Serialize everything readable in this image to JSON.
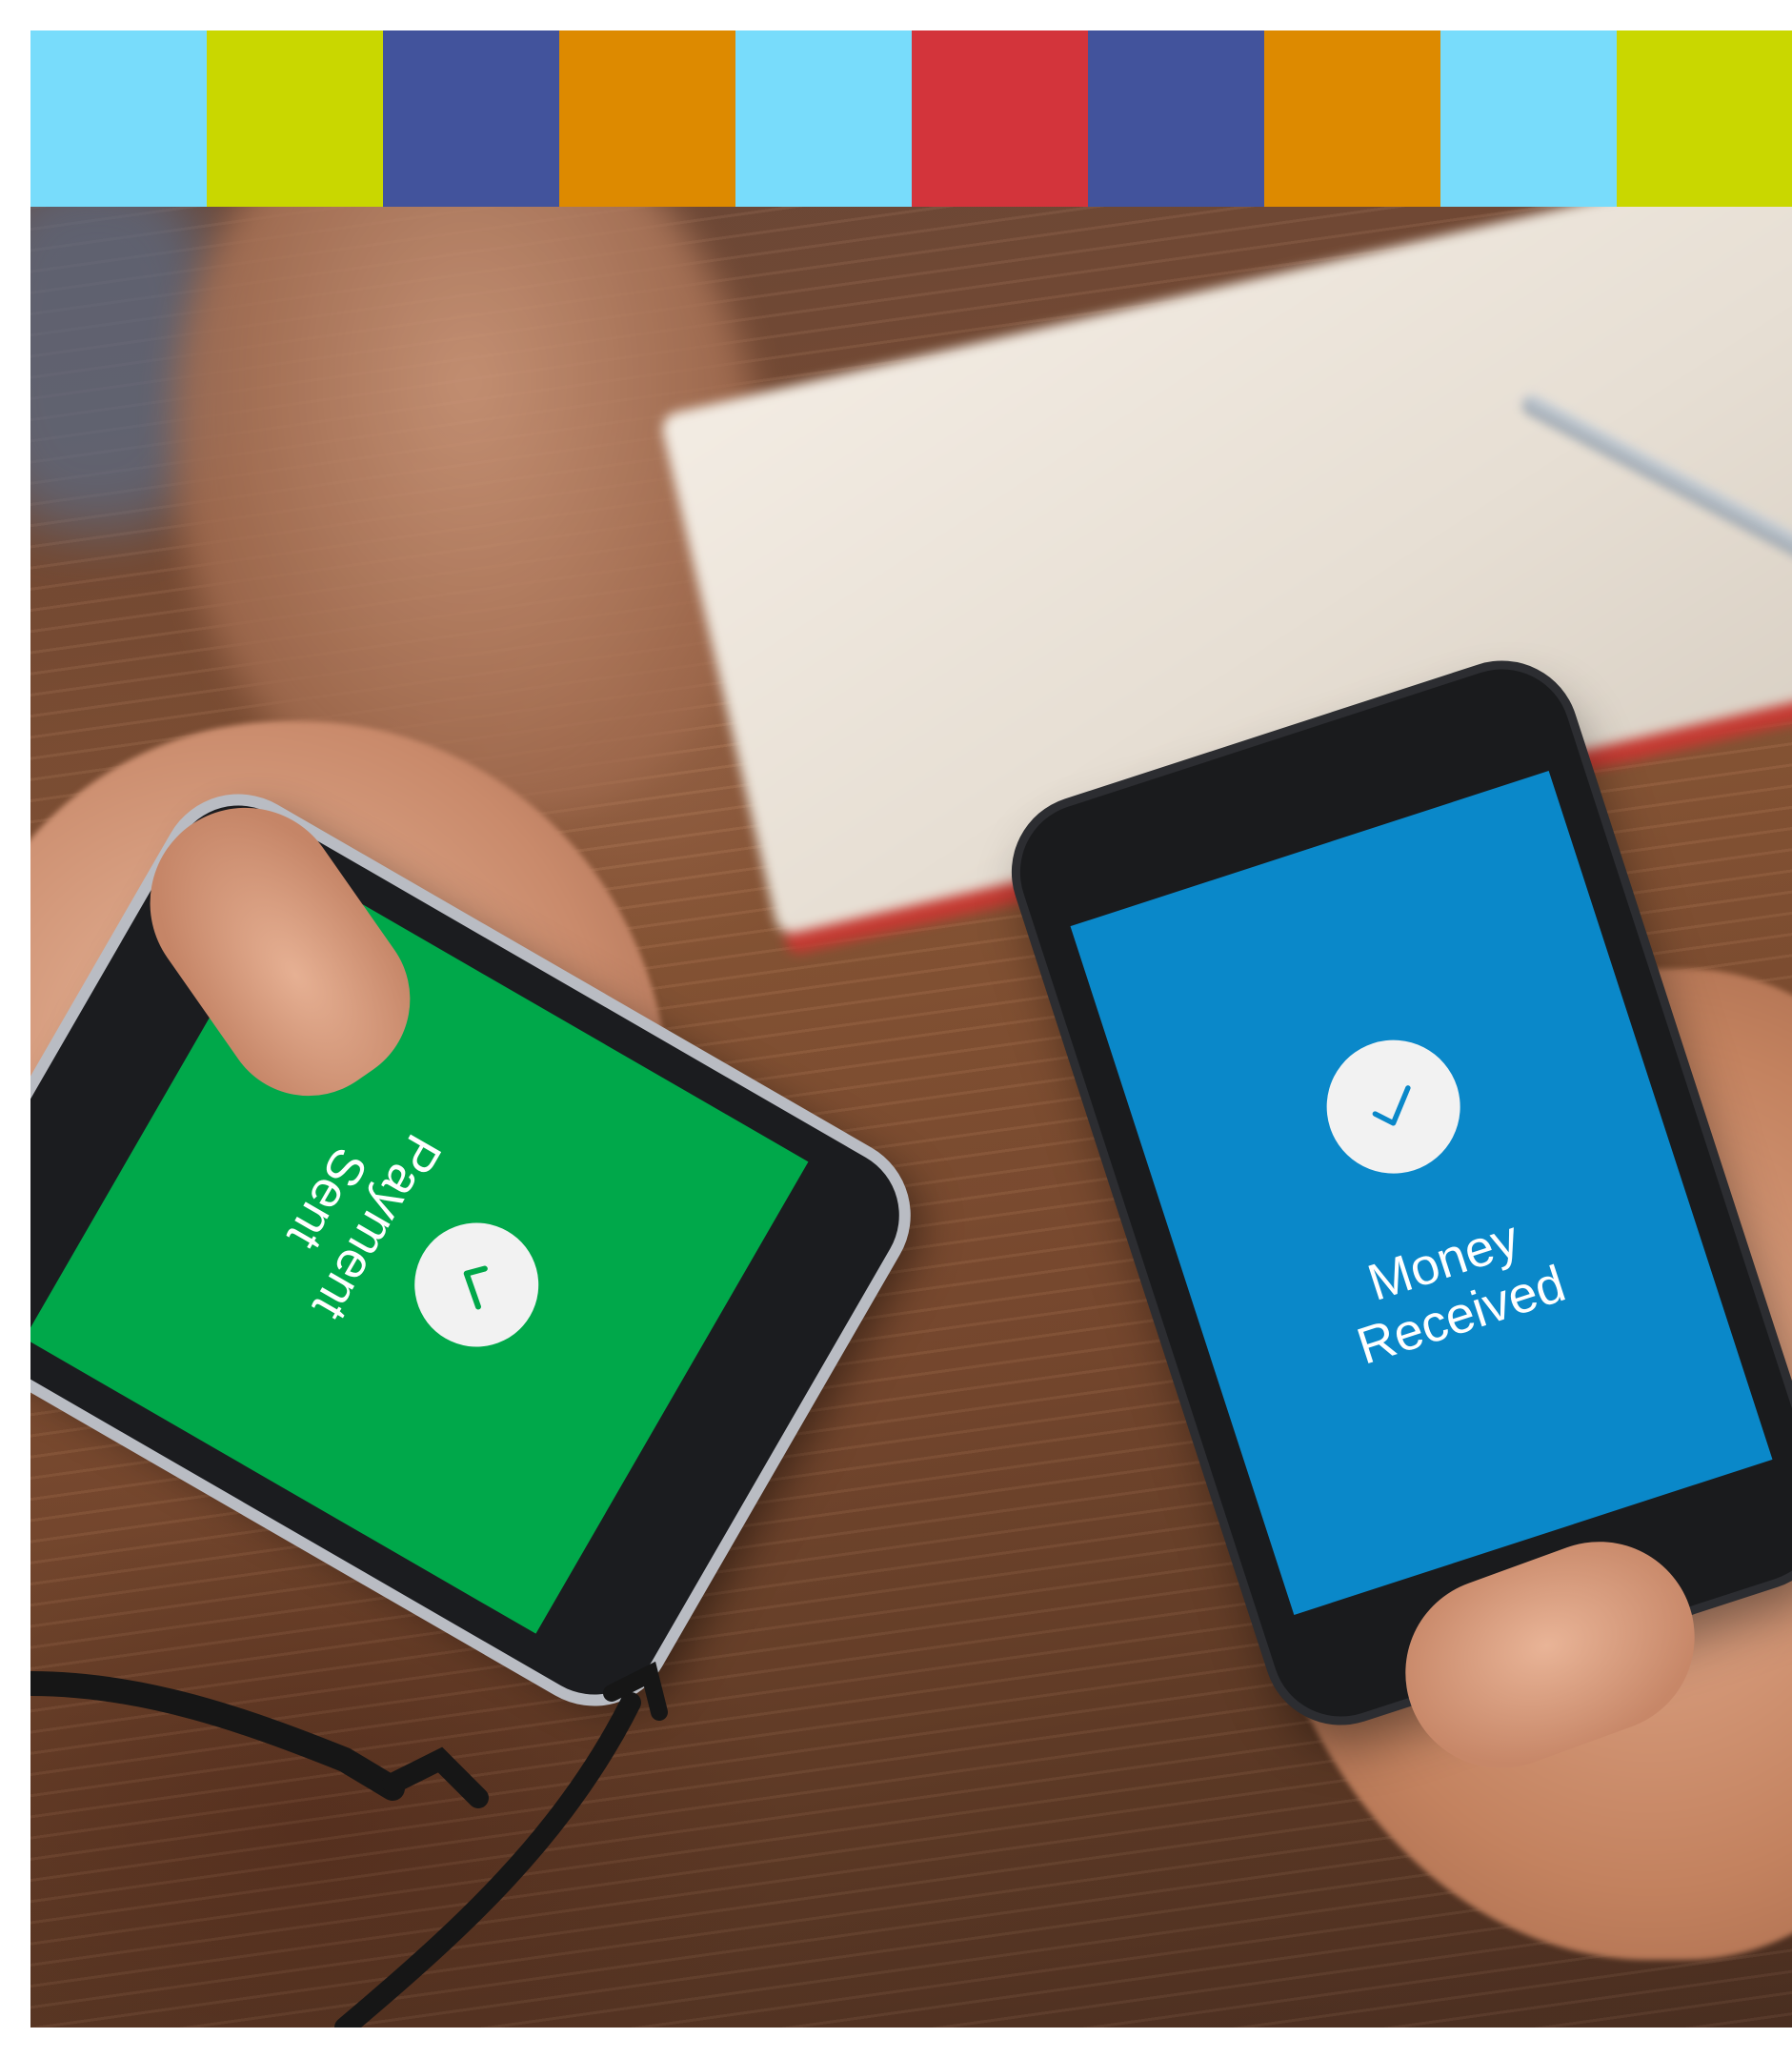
{
  "color_bar": [
    "#78dcfb",
    "#c9d700",
    "#42539c",
    "#dd8a00",
    "#78dcfb",
    "#d3343b",
    "#42539c",
    "#dd8a00",
    "#78dcfb",
    "#c9d700"
  ],
  "left_phone": {
    "screen_color": "#00a84a",
    "line1": "Payment",
    "line2": "Sent",
    "icon": "check-icon"
  },
  "right_phone": {
    "screen_color": "#0a88c9",
    "line1": "Money",
    "line2": "Received",
    "icon": "check-icon"
  }
}
